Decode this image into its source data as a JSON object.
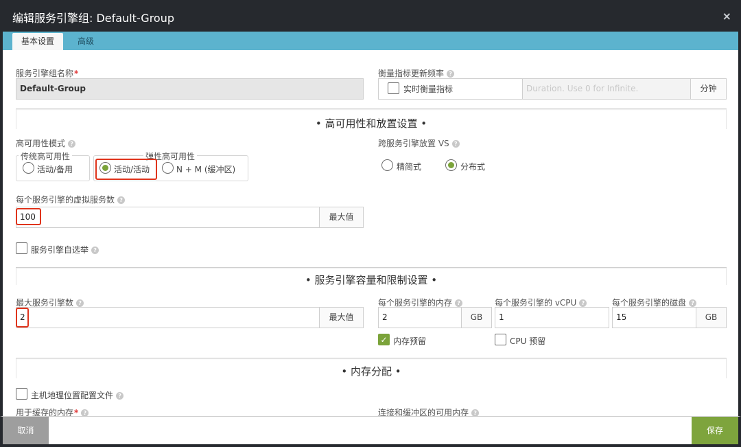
{
  "window": {
    "title": "编辑服务引擎组: Default-Group",
    "close": "×"
  },
  "tabs": [
    {
      "label": "基本设置"
    },
    {
      "label": "高级"
    }
  ],
  "basic": {
    "group_name_label": "服务引擎组名称",
    "required_mark": "*",
    "group_name_value": "Default-Group",
    "metrics_label": "衡量指标更新频率",
    "realtime_metrics_label": "实时衡量指标",
    "duration_placeholder": "Duration. Use 0 for Infinite.",
    "duration_unit": "分钟"
  },
  "ha_section": {
    "title": "• 高可用性和放置设置 •",
    "ha_mode_label": "高可用性模式",
    "legacy_legend": "传统高可用性",
    "legacy_option": "活动/备用",
    "elastic_legend": "弹性高可用性",
    "active_active_option": "活动/活动",
    "nm_option": "N + M (缓冲区)",
    "placement_label": "跨服务引擎放置 VS",
    "compact_option": "精简式",
    "distributed_option": "分布式",
    "vs_per_se_label": "每个服务引擎的虚拟服务数",
    "vs_per_se_value": "100",
    "max_button": "最大值",
    "self_election_label": "服务引擎自选举"
  },
  "capacity_section": {
    "title": "• 服务引擎容量和限制设置 •",
    "max_se_label": "最大服务引擎数",
    "max_se_value": "2",
    "max_button": "最大值",
    "memory_label": "每个服务引擎的内存",
    "memory_value": "2",
    "memory_unit": "GB",
    "vcpu_label": "每个服务引擎的 vCPU",
    "vcpu_value": "1",
    "disk_label": "每个服务引擎的磁盘",
    "disk_value": "15",
    "disk_unit": "GB",
    "memory_reserve_label": "内存预留",
    "cpu_reserve_label": "CPU 预留",
    "check_mark": "✓"
  },
  "memory_section": {
    "title": "• 内存分配 •",
    "host_geo_label": "主机地理位置配置文件",
    "cache_memory_label": "用于缓存的内存",
    "conn_buffer_label": "连接和缓冲区的可用内存"
  },
  "footer": {
    "cancel": "取消",
    "save": "保存"
  },
  "help_glyph": "?",
  "colors": {
    "accent_green": "#7ea43d",
    "tab_bar": "#5cb3ce",
    "title_bar": "#26292e",
    "highlight": "#e0341c"
  }
}
